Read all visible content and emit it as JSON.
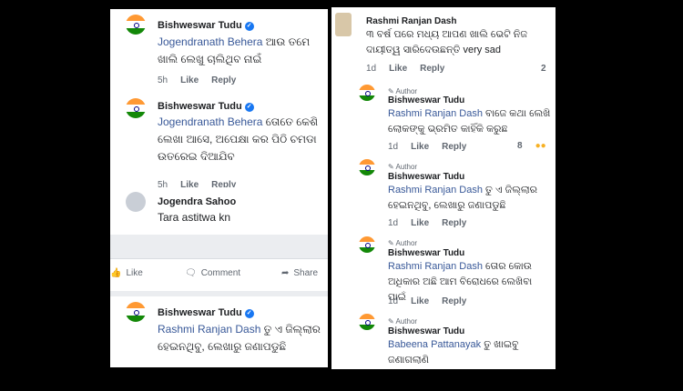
{
  "left": {
    "comments": [
      {
        "author": "Bishweswar Tudu",
        "verified_icon": "check-icon",
        "mention": "Jogendranath Behera",
        "text": " ଆଉ ତମେ ଖାଲି ଲେଖୁ ଚାଲିଥିବ ନାଇଁ",
        "time": "5h",
        "like": "Like",
        "reply": "Reply"
      },
      {
        "author": "Bishweswar Tudu",
        "verified_icon": "check-icon",
        "mention": "Jogendranath Behera",
        "text": " ତୋତେ କେଶି ଲେଖା ଆସେ, ଅପେକ୍ଷା କର ପିଠି ଚମଡା ଉତରେଇ ଦିଆଯିବ",
        "time": "5h",
        "like": "Like",
        "reply": "Reply"
      },
      {
        "author": "Jogendra Sahoo",
        "text": "Tara astitwa kn"
      },
      {
        "author": "Bishweswar Tudu",
        "verified_icon": "check-icon",
        "mention": "Rashmi Ranjan Dash",
        "text": " ତୁ ଏ ଜିଲ୍ଲାର ହେଇନଥିବୁ, ଲେଖାରୁ ଜଣାପଡୁଛି"
      }
    ],
    "actions": {
      "like": "Like",
      "comment": "Comment",
      "share": "Share",
      "like_icon": "thumbs-up-icon",
      "comment_icon": "speech-bubble-icon",
      "share_icon": "share-arrow-icon"
    }
  },
  "right": {
    "top": {
      "author": "Rashmi Ranjan Dash",
      "text": "୩ ବର୍ଷ ପରେ ମଧ୍ୟ ଆପଣ ଖାଲି ଭେଟି ନିଜ ଦାୟୀତ୍ୱ ସାରିଦେଉଛନ୍ତି very sad",
      "time": "1d",
      "like": "Like",
      "reply": "Reply",
      "count": "2"
    },
    "replies": [
      {
        "badge": "Author",
        "author": "Bishweswar Tudu",
        "mention": "Rashmi Ranjan Dash",
        "text": " ବାଜେ କଥା ଲେଖି ଲୋକଙ୍କୁ ଭ୍ରମିତ କାହିଁକି କରୁଛ",
        "time": "1d",
        "like": "Like",
        "reply": "Reply",
        "count": "8"
      },
      {
        "badge": "Author",
        "author": "Bishweswar Tudu",
        "mention": "Rashmi Ranjan Dash",
        "text": " ତୁ ଏ ଜିଲ୍ଲାର ହେଇନଥିବୁ, ଲେଖାରୁ ଜଣାପଡୁଛି",
        "time": "1d",
        "like": "Like",
        "reply": "Reply"
      },
      {
        "badge": "Author",
        "author": "Bishweswar Tudu",
        "mention": "Rashmi Ranjan Dash",
        "text": " ତୋର କୋଉ ଅଧିକାର ଅଛି ଆମ ବିରୋଧରେ ଲେଖିବା ପାଇଁ",
        "time": "1d",
        "like": "Like",
        "reply": "Reply"
      },
      {
        "badge": "Author",
        "author": "Bishweswar Tudu",
        "mention": "Babeena Pattanayak",
        "text": " ତୁ ଖାଇବୁ ଜଣାଗଲାଣି"
      }
    ]
  },
  "colors": {
    "mention": "#385898",
    "verified": "#1877f2",
    "flag_saffron": "#ff9933",
    "flag_green": "#138808"
  }
}
